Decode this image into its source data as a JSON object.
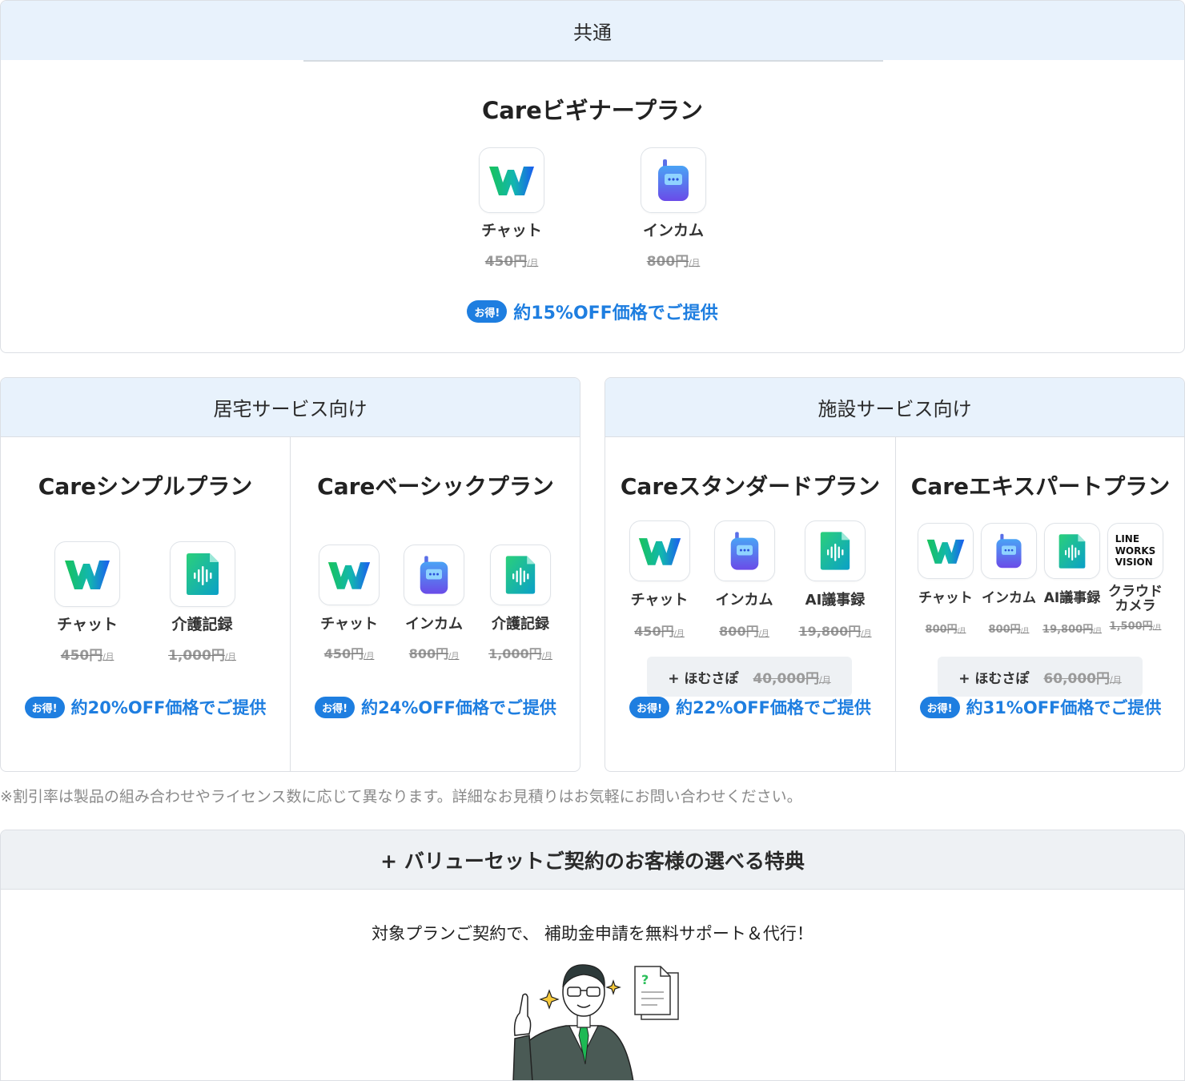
{
  "common": {
    "header": "共通",
    "plan": {
      "title": "Careビギナープラン",
      "apps": [
        {
          "name": "チャット",
          "price": "450円",
          "icon": "works-w-icon"
        },
        {
          "name": "インカム",
          "price": "800円",
          "icon": "intercom-icon"
        }
      ],
      "badge": "お得!",
      "deal": "約15%OFF価格でご提供"
    }
  },
  "per_month": "/月",
  "home": {
    "header": "居宅サービス向け",
    "plans": [
      {
        "title": "Careシンプルプラン",
        "apps": [
          {
            "name": "チャット",
            "price": "450円",
            "icon": "works-w-icon"
          },
          {
            "name": "介護記録",
            "price": "1,000円",
            "icon": "care-record-icon"
          }
        ],
        "badge": "お得!",
        "deal": "約20%OFF価格でご提供"
      },
      {
        "title": "Careベーシックプラン",
        "apps": [
          {
            "name": "チャット",
            "price": "450円",
            "icon": "works-w-icon"
          },
          {
            "name": "インカム",
            "price": "800円",
            "icon": "intercom-icon"
          },
          {
            "name": "介護記録",
            "price": "1,000円",
            "icon": "care-record-icon"
          }
        ],
        "badge": "お得!",
        "deal": "約24%OFF価格でご提供"
      }
    ]
  },
  "facility": {
    "header": "施設サービス向け",
    "plans": [
      {
        "title": "Careスタンダードプラン",
        "apps": [
          {
            "name": "チャット",
            "price": "450円",
            "icon": "works-w-icon"
          },
          {
            "name": "インカム",
            "price": "800円",
            "icon": "intercom-icon"
          },
          {
            "name": "AI議事録",
            "price": "19,800円",
            "icon": "ai-minutes-icon"
          }
        ],
        "addon_label": "+ ほむさぽ",
        "addon_price": "40,000円",
        "badge": "お得!",
        "deal": "約22%OFF価格でご提供"
      },
      {
        "title": "Careエキスパートプラン",
        "apps": [
          {
            "name": "チャット",
            "price": "800円",
            "icon": "works-w-icon"
          },
          {
            "name": "インカム",
            "price": "800円",
            "icon": "intercom-icon"
          },
          {
            "name": "AI議事録",
            "price": "19,800円",
            "icon": "ai-minutes-icon"
          },
          {
            "name": "クラウド\nカメラ",
            "price": "1,500円",
            "icon": "lineworks-vision-icon",
            "logo_text": "LINE\nWORKS\nVISION"
          }
        ],
        "addon_label": "+ ほむさぽ",
        "addon_price": "60,000円",
        "badge": "お得!",
        "deal": "約31%OFF価格でご提供"
      }
    ]
  },
  "note": "※割引率は製品の組み合わせやライセンス数に応じて異なります。詳細なお見積りはお気軽にお問い合わせください。",
  "benefit": {
    "header": "+ バリューセットご契約のお客様の選べる特典",
    "text": "対象プランご契約で、 補助金申請を無料サポート＆代行！"
  },
  "colors": {
    "accent": "#1e7ee0",
    "head_blue": "#e8f2fc",
    "head_gray": "#eef1f4"
  }
}
